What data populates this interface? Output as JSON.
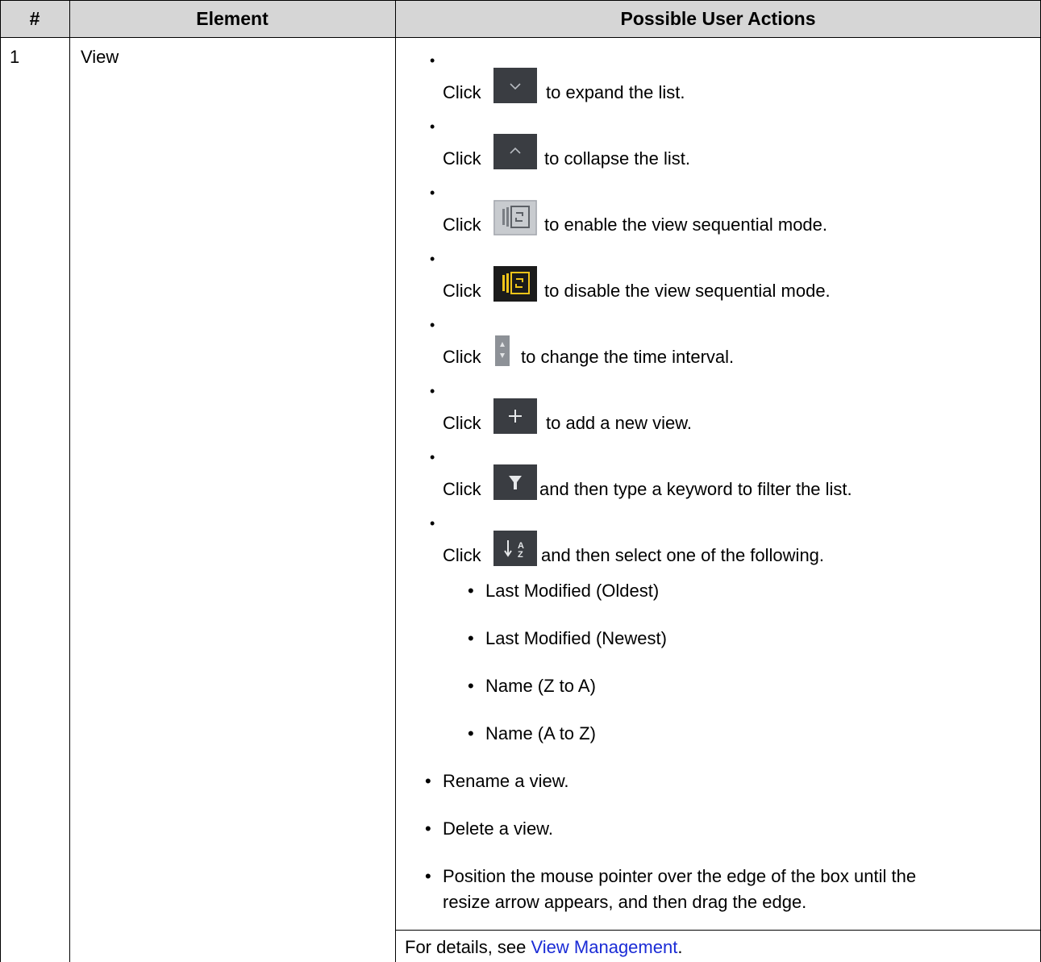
{
  "table": {
    "headers": [
      "#",
      "Element",
      "Possible User Actions"
    ],
    "row": {
      "number": "1",
      "element": "View",
      "actions": [
        {
          "prefix": "Click",
          "icon": "chevron-down-icon",
          "text": "to expand the list."
        },
        {
          "prefix": "Click",
          "icon": "chevron-up-icon",
          "text": "to collapse the list."
        },
        {
          "prefix": "Click",
          "icon": "sequential-mode-icon",
          "text": "to enable the view sequential mode."
        },
        {
          "prefix": "Click",
          "icon": "sequential-mode-active-icon",
          "text": "to disable the view sequential mode."
        },
        {
          "prefix": "Click",
          "icon": "spinner-arrows-icon",
          "text": "to change the time interval."
        },
        {
          "prefix": "Click",
          "icon": "plus-icon",
          "text": "to add a new view."
        },
        {
          "prefix": "Click",
          "icon": "filter-icon",
          "text": "and then type a keyword to filter the list."
        },
        {
          "prefix": "Click",
          "icon": "sort-icon",
          "text": "and then select one of the following."
        }
      ],
      "sort_options": [
        "Last Modified (Oldest)",
        "Last Modified (Newest)",
        "Name (Z to A)",
        "Name (A to Z)"
      ],
      "other_actions": [
        "Rename a view.",
        "Delete a view.",
        "Position the mouse pointer over the edge of the box until the",
        "resize arrow appears, and then drag the edge."
      ],
      "details_prefix": "For details, see ",
      "details_link": "View Management",
      "details_suffix": "."
    }
  },
  "colors": {
    "header_bg": "#d6d6d6",
    "icon_bg": "#3a3d42",
    "icon_active": "#f0c419",
    "link": "#1a2bd6"
  }
}
